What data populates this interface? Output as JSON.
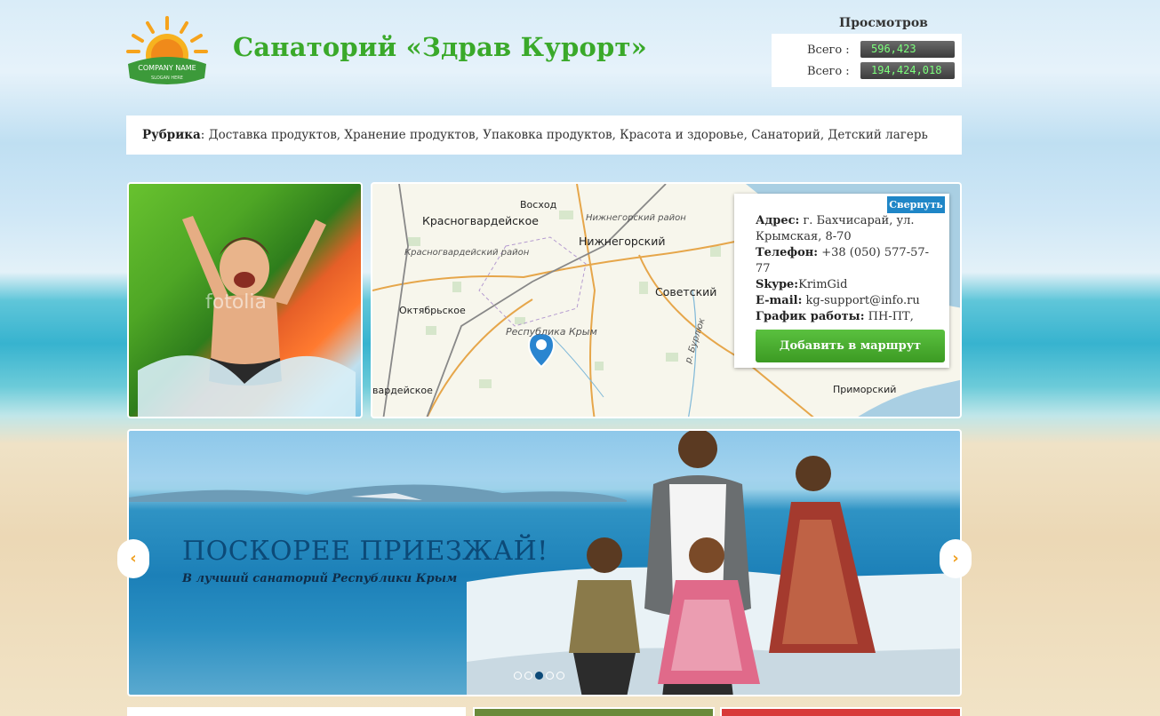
{
  "header": {
    "logo_text": "COMPANY NAME",
    "logo_slogan": "SLOGAN HERE",
    "site_title": "Санаторий «Здрав Курорт»"
  },
  "views": {
    "heading": "Просмотров",
    "rows": [
      {
        "label": "Всего :",
        "count": "596,423"
      },
      {
        "label": "Всего :",
        "count": "194,424,018"
      }
    ]
  },
  "rubric": {
    "label": "Рубрика",
    "text": ": Доставка продуктов, Хранение продуктов, Упаковка продуктов, Красота и здоровье, Санаторий, Детский лагерь"
  },
  "photo": {
    "watermark": "fotolia"
  },
  "map": {
    "labels": {
      "voskhod": "Восход",
      "krasnogvardeyskoe": "Красногвардейское",
      "nizhnegorsky": "Нижнегорский",
      "sovetsky": "Советский",
      "oktyabrskoe": "Октябрьское",
      "respublika": "Республика Крым",
      "primorsky": "Приморский",
      "gvardeyskoe": "вардейское",
      "nizhnegorsky_rayon": "Нижнегорский район",
      "krasnogvardeysky_rayon": "Красногвардейский район",
      "river": "р. Бурлюк"
    }
  },
  "info_card": {
    "collapse_label": "Свернуть",
    "address_label": "Адрес:",
    "address_value": " г. Бахчисарай, ул. Крымская, 8-70",
    "phone_label": "Телефон:",
    "phone_value": " +38 (050) 577-57-77",
    "skype_label": "Skype:",
    "skype_value": "KrimGid",
    "email_label": "E-mail:",
    "email_value": " kg-support@info.ru",
    "hours_label": "График работы:",
    "hours_value": " ПН-ПТ, круглосуточно",
    "route_button": "Добавить в маршрут"
  },
  "slider": {
    "title": "ПОСКОРЕЕ ПРИЕЗЖАЙ!",
    "subtitle": "В лучший санаторий Республики Крым",
    "prev": "‹",
    "next": "›",
    "dot_count": 5,
    "active_dot": 3
  },
  "colors": {
    "title_green": "#3aa92a",
    "button_green": "#3c9a23",
    "collapse_blue": "#1f86c7",
    "slide_title": "#0c4a78",
    "arrow_orange": "#f0a020"
  }
}
